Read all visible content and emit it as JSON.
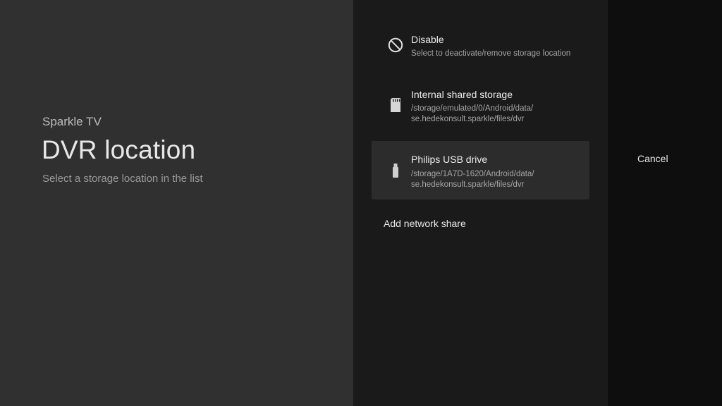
{
  "guidance": {
    "breadcrumb": "Sparkle TV",
    "title": "DVR location",
    "description": "Select a storage location in the list"
  },
  "actions": [
    {
      "label": "Disable",
      "description": "Select to deactivate/remove storage location",
      "icon": "block-icon"
    },
    {
      "label": "Internal shared storage",
      "description_line1": "/storage/emulated/0/Android/data/",
      "description_line2": "se.hedekonsult.sparkle/files/dvr",
      "icon": "sd-card-icon"
    },
    {
      "label": "Philips USB drive",
      "description_line1": "/storage/1A7D-1620/Android/data/",
      "description_line2": "se.hedekonsult.sparkle/files/dvr",
      "icon": "usb-drive-icon",
      "focused": true
    },
    {
      "label": "Add network share"
    }
  ],
  "side_actions": {
    "cancel": "Cancel"
  },
  "colors": {
    "guidance_bg": "#303030",
    "actions_bg": "#1a1a1a",
    "focused_bg": "#2c2c2c",
    "side_bg": "#0e0e0e"
  }
}
